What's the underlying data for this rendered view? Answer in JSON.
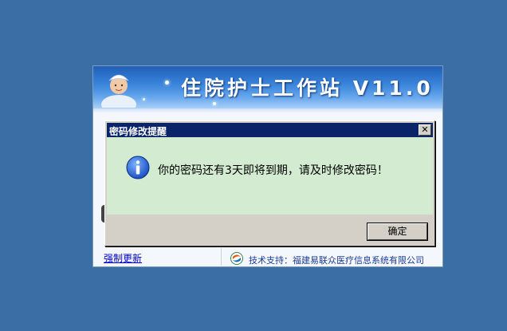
{
  "login_window": {
    "title": "住院护士工作站 V11.0",
    "force_update_link": "强制更新",
    "tech_support": "技术支持：福建易联众医疗信息系统有限公司"
  },
  "dialog": {
    "title": "密码修改提醒",
    "close_symbol": "✕",
    "message": "你的密码还有3天即将到期，请及时修改密码！",
    "ok_button_label": "确定"
  },
  "icons": {
    "dialog_icon": "info-icon",
    "banner_icon": "nurse-avatar",
    "support_icon": "company-logo"
  },
  "colors": {
    "desktop": "#3a6ea5",
    "dialog_titlebar": "#0a246a",
    "message_area": "#d3ebd0",
    "link": "#0000cc"
  }
}
